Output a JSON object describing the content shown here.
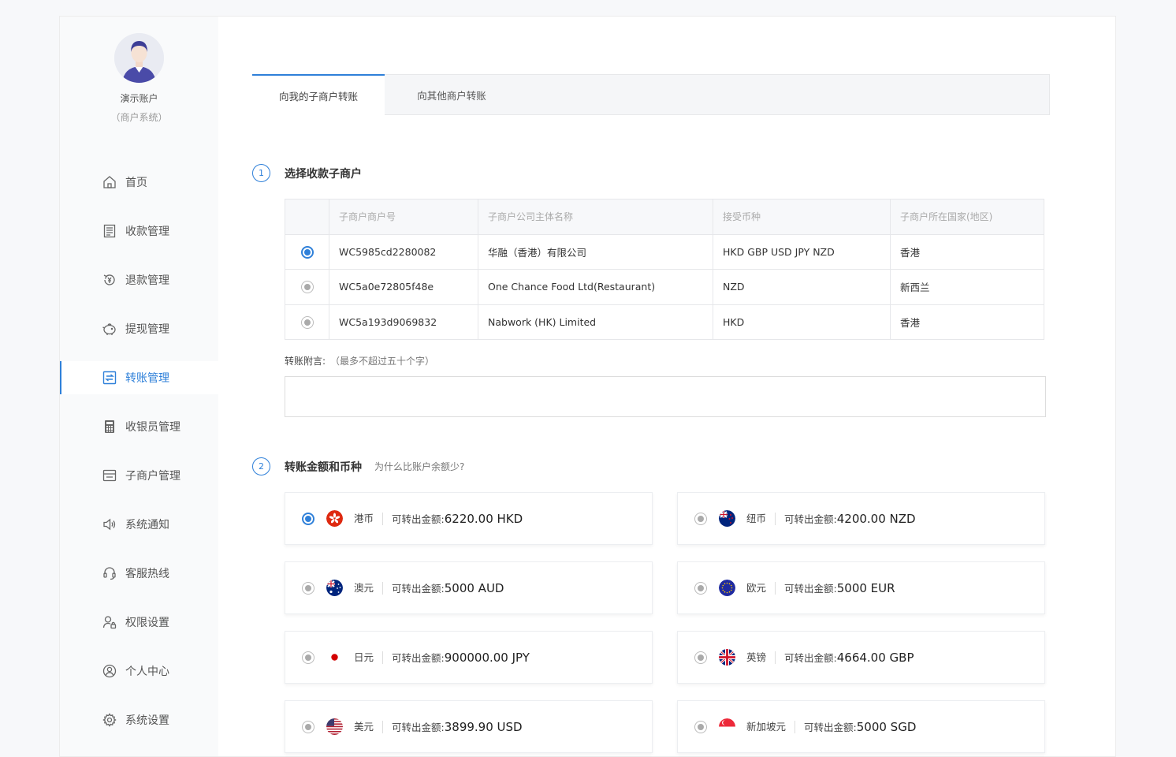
{
  "account": {
    "name": "演示账户",
    "subtitle": "（商户系统）"
  },
  "nav": [
    {
      "label": "首页",
      "icon": "home-icon"
    },
    {
      "label": "收款管理",
      "icon": "receipt-icon"
    },
    {
      "label": "退款管理",
      "icon": "refund-icon"
    },
    {
      "label": "提现管理",
      "icon": "piggy-bank-icon"
    },
    {
      "label": "转账管理",
      "icon": "transfer-icon",
      "active": true
    },
    {
      "label": "收银员管理",
      "icon": "calculator-icon"
    },
    {
      "label": "子商户管理",
      "icon": "store-icon"
    },
    {
      "label": "系统通知",
      "icon": "speaker-icon"
    },
    {
      "label": "客服热线",
      "icon": "headset-icon"
    },
    {
      "label": "权限设置",
      "icon": "user-lock-icon"
    },
    {
      "label": "个人中心",
      "icon": "user-circle-icon"
    },
    {
      "label": "系统设置",
      "icon": "gear-icon"
    }
  ],
  "tabs": [
    {
      "label": "向我的子商户转账",
      "active": true
    },
    {
      "label": "向其他商户转账"
    }
  ],
  "step1": {
    "num": "1",
    "title": "选择收款子商户"
  },
  "table": {
    "headers": [
      "子商户商户号",
      "子商户公司主体名称",
      "接受币种",
      "子商户所在国家(地区)"
    ],
    "rows": [
      {
        "id": "WC5985cd2280082",
        "name": "华融（香港）有限公司",
        "currencies": "HKD GBP USD JPY NZD",
        "region": "香港",
        "selected": true
      },
      {
        "id": "WC5a0e72805f48e",
        "name": "One Chance Food Ltd(Restaurant)",
        "currencies": "NZD",
        "region": "新西兰",
        "selected": false
      },
      {
        "id": "WC5a193d9069832",
        "name": "Nabwork (HK) Limited",
        "currencies": "HKD",
        "region": "香港",
        "selected": false
      }
    ]
  },
  "memo": {
    "label": "转账附言:",
    "hint": "（最多不超过五十个字）",
    "value": ""
  },
  "step2": {
    "num": "2",
    "title": "转账金额和币种",
    "hint": "为什么比账户余额少?"
  },
  "available_label": "可转出金额:",
  "currencies": [
    {
      "name": "港币",
      "amount": "6220.00 HKD",
      "flag": "hk-flag-icon",
      "selected": true
    },
    {
      "name": "纽币",
      "amount": "4200.00 NZD",
      "flag": "nz-flag-icon",
      "selected": false
    },
    {
      "name": "澳元",
      "amount": "5000 AUD",
      "flag": "au-flag-icon",
      "selected": false
    },
    {
      "name": "欧元",
      "amount": "5000 EUR",
      "flag": "eu-flag-icon",
      "selected": false
    },
    {
      "name": "日元",
      "amount": "900000.00 JPY",
      "flag": "jp-flag-icon",
      "selected": false
    },
    {
      "name": "英镑",
      "amount": "4664.00 GBP",
      "flag": "gb-flag-icon",
      "selected": false
    },
    {
      "name": "美元",
      "amount": "3899.90 USD",
      "flag": "us-flag-icon",
      "selected": false
    },
    {
      "name": "新加坡元",
      "amount": "5000 SGD",
      "flag": "sg-flag-icon",
      "selected": false
    }
  ],
  "colors": {
    "accent": "#2f80d9",
    "sidebar_bg": "#f9fafb"
  }
}
